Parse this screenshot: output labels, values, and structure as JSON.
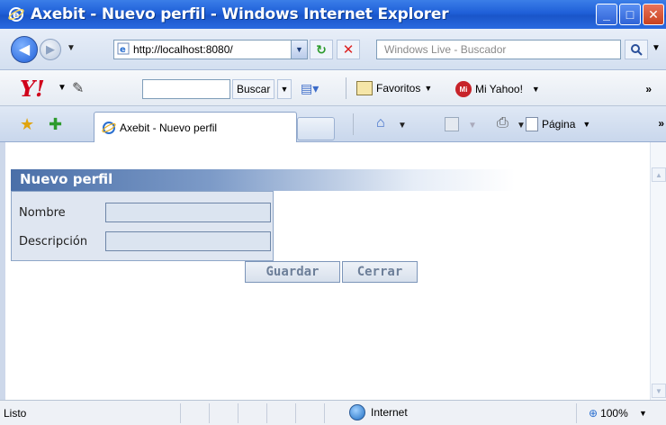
{
  "window": {
    "title": "Axebit - Nuevo perfil - Windows Internet Explorer"
  },
  "address": {
    "url": "http://localhost:8080/",
    "search_placeholder": "Windows Live - Buscador"
  },
  "yahoo": {
    "search_button": "Buscar",
    "favorites": "Favoritos",
    "my_yahoo": "Mi Yahoo!",
    "my_icon": "Mi"
  },
  "tabs": {
    "active": "Axebit - Nuevo perfil",
    "page_menu": "Página"
  },
  "form": {
    "title": "Nuevo perfil",
    "name_label": "Nombre",
    "name_value": "",
    "desc_label": "Descripción",
    "desc_value": "",
    "save_label": "Guardar",
    "close_label": "Cerrar"
  },
  "status": {
    "text": "Listo",
    "zone": "Internet",
    "zoom": "100%"
  },
  "colors": {
    "titlebar": "#1f5fd8",
    "panel_header": "#4a6fa8",
    "form_bg": "#dfe6f1"
  }
}
